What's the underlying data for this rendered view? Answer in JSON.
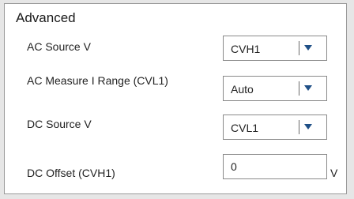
{
  "section": {
    "title": "Advanced"
  },
  "rows": [
    {
      "label": "AC Source V",
      "value": "CVH1"
    },
    {
      "label": "AC Measure I Range (CVL1)",
      "value": "Auto"
    },
    {
      "label": "DC Source V",
      "value": "CVL1"
    },
    {
      "label": "DC Offset (CVH1)",
      "value": "0",
      "unit": "V"
    }
  ],
  "icons": {
    "dropdown": "chevron-down-icon"
  },
  "colors": {
    "caret": "#1f4f86",
    "border": "#8a8a8a",
    "panel_border": "#9a9a9a",
    "background": "#e6e6e6"
  }
}
